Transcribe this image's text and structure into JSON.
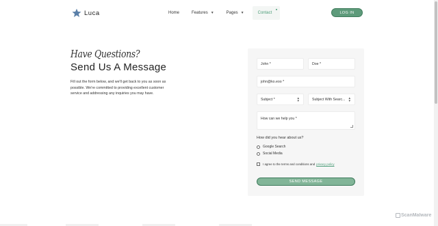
{
  "header": {
    "logo_text": "Luca",
    "nav": [
      {
        "label": "Home"
      },
      {
        "label": "Features"
      },
      {
        "label": "Pages"
      },
      {
        "label": "Contact"
      }
    ],
    "login_label": "LOG IN"
  },
  "hero": {
    "kicker": "Have Questions?",
    "title": "Send Us A Message",
    "intro": "Fill out the form below, and we'll get back to you as soon as possible. We're committed to providing excellent customer service and addressing any inquiries you may have."
  },
  "form": {
    "first_name_placeholder": "John *",
    "last_name_placeholder": "Doe *",
    "email_placeholder": "john@ko.eoo *",
    "subject_select": "Subject *",
    "subject_search_select": "Subject With Searc...",
    "message_placeholder": "How can we help you *",
    "question_label": "How did you hear about us?",
    "options": [
      "Google Search",
      "Social Media"
    ],
    "agree_text": "I agree to the terms and conditions and",
    "privacy_link": "privacy policy",
    "submit_label": "SEND MESSAGE"
  },
  "watermark": {
    "text": "ScanMalware"
  },
  "colors": {
    "accent": "#4a9c77",
    "button": "#5e9b7b",
    "card": "#f6f6f6"
  }
}
